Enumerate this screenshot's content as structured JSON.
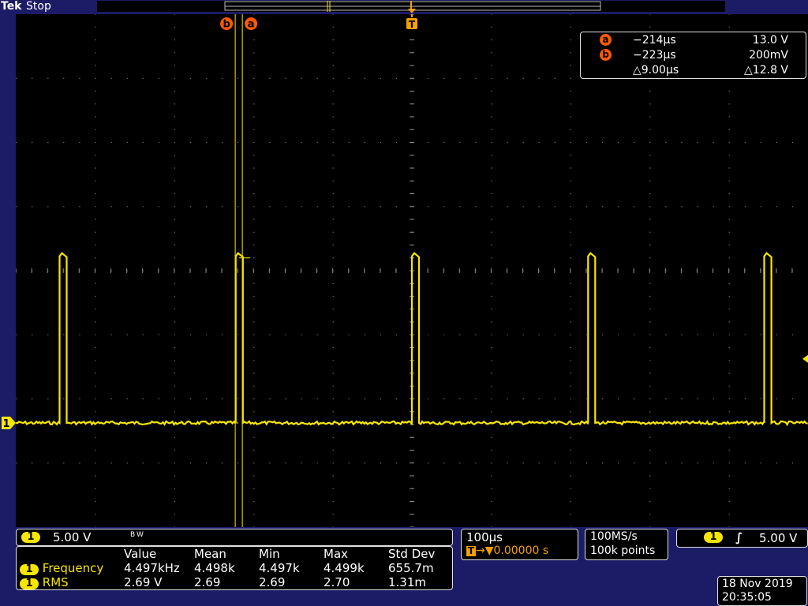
{
  "header": {
    "brand": "Tek",
    "status": "Stop"
  },
  "colors": {
    "channel1": "#f7e600",
    "cursor": "#ff5a00",
    "trigger": "#f7a000",
    "background": "#1c1b66",
    "graticule": "#000000"
  },
  "markers": {
    "cursor_a": "a",
    "cursor_b": "b",
    "trigger": "T",
    "channel": "1"
  },
  "cursor_readout": {
    "rows": [
      {
        "badge": "a",
        "time": "−214µs",
        "value": "13.0 V"
      },
      {
        "badge": "b",
        "time": "−223µs",
        "value": "200mV"
      }
    ],
    "delta_time": "△9.00µs",
    "delta_value": "△12.8 V"
  },
  "channel_scale": {
    "channel": "1",
    "volts_per_div": "5.00 V",
    "bw_limit": "B W"
  },
  "measurements": {
    "headers": [
      "",
      "Value",
      "Mean",
      "Min",
      "Max",
      "Std Dev"
    ],
    "rows": [
      {
        "channel": "1",
        "name": "Frequency",
        "value": "4.497kHz",
        "mean": "4.498k",
        "min": "4.497k",
        "max": "4.499k",
        "std_dev": "655.7m"
      },
      {
        "channel": "1",
        "name": "RMS",
        "value": "2.69 V",
        "mean": "2.69",
        "min": "2.69",
        "max": "2.70",
        "std_dev": "1.31m"
      }
    ]
  },
  "timebase": {
    "time_per_div": "100µs",
    "trigger_badge": "T",
    "delay": "→▼0.00000 s"
  },
  "acquisition": {
    "sample_rate": "100MS/s",
    "record_length": "100k points"
  },
  "trigger": {
    "channel": "1",
    "level": "5.00 V"
  },
  "datetime": {
    "date": "18 Nov 2019",
    "time": "20:35:05"
  },
  "waveform": {
    "frequency_khz": 4.497,
    "high_level_v": 13.0,
    "low_level_v": 0.2,
    "pulse_width_us": 9.0,
    "time_per_div_us": 100,
    "volts_per_div": 5.0
  }
}
